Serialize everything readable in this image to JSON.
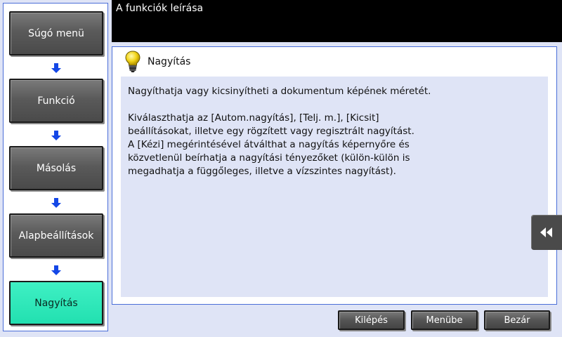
{
  "header": {
    "title": "A funkciók leírása"
  },
  "nav": {
    "items": [
      {
        "label": "Súgó menü",
        "active": false
      },
      {
        "label": "Funkció",
        "active": false
      },
      {
        "label": "Másolás",
        "active": false
      },
      {
        "label": "Alapbeállítások",
        "active": false
      },
      {
        "label": "Nagyítás",
        "active": true
      }
    ],
    "arrow_color": "#1447e6",
    "active_color": "#2ae8b8"
  },
  "content": {
    "icon": "lightbulb-icon",
    "title": "Nagyítás",
    "paragraph1": "Nagyíthatja vagy kicsinyítheti a dokumentum képének méretét.",
    "paragraph2_lines": [
      "Kiválaszthatja az [Autom.nagyítás], [Telj. m.], [Kicsit]",
      "beállításokat, illetve egy rögzített vagy regisztrált nagyítást.",
      "A [Kézi] megérintésével átválthat a nagyítás képernyőre és",
      "közvetlenül beírhatja a nagyítási tényezőket (külön-külön is",
      "megadhatja a függőleges, illetve a vízszintes nagyítást)."
    ]
  },
  "side_tab": {
    "icon": "double-chevron-left-icon"
  },
  "buttons": {
    "exit": "Kilépés",
    "menu": "Menübe",
    "close": "Bezár"
  }
}
